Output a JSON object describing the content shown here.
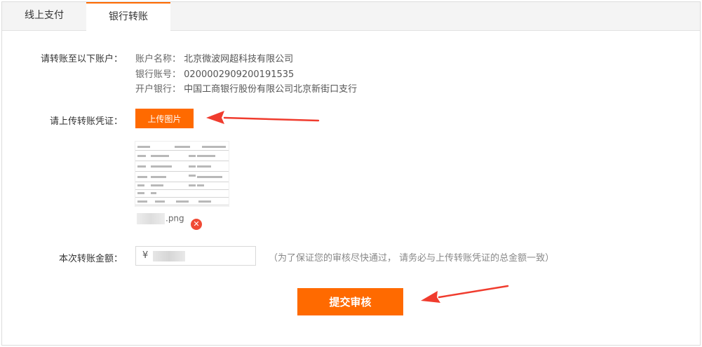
{
  "tabs": [
    {
      "label": "线上支付",
      "active": false
    },
    {
      "label": "银行转账",
      "active": true
    }
  ],
  "account_section": {
    "label": "请转账至以下账户：",
    "name_key": "账户名称：",
    "name_value": "北京微波网超科技有限公司",
    "number_key": "银行账号：",
    "number_value": "0200002909200191535",
    "bank_key": "开户银行：",
    "bank_value": "中国工商银行股份有限公司北京新街口支行"
  },
  "upload": {
    "label": "请上传转账凭证：",
    "button_label": "上传图片",
    "file_ext": ".png",
    "remove_icon": "close-icon"
  },
  "amount": {
    "label": "本次转账金额：",
    "currency_symbol": "¥",
    "value": "",
    "hint": "（为了保证您的审核尽快通过， 请务必与上传转账凭证的总金额一致）"
  },
  "submit": {
    "label": "提交审核"
  },
  "colors": {
    "accent": "#ff6a00",
    "arrow": "#f03c2e",
    "remove": "#f04a35"
  }
}
